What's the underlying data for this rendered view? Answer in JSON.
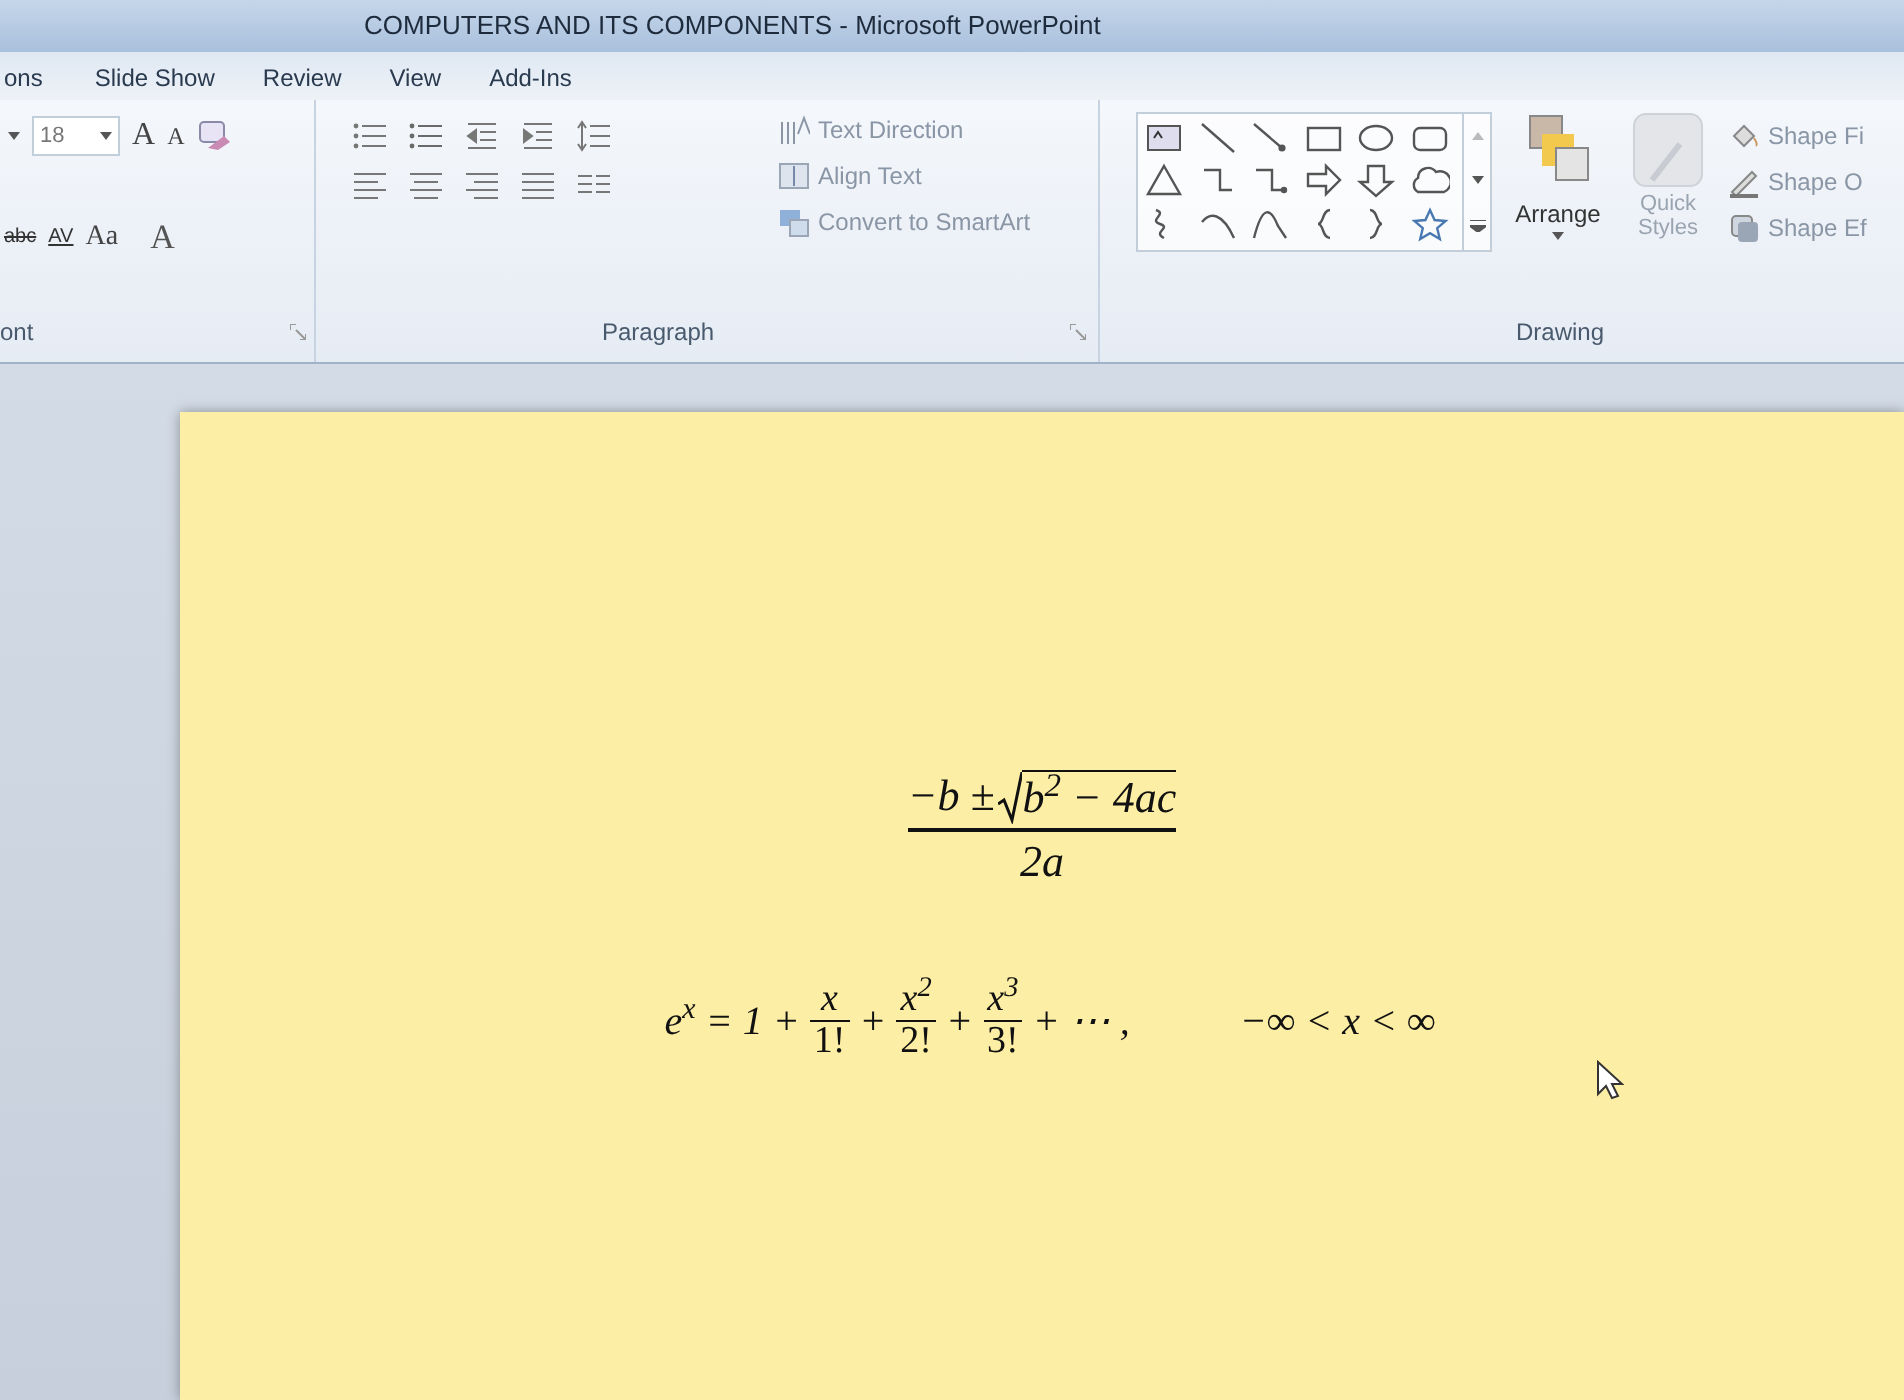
{
  "window": {
    "title": "COMPUTERS AND ITS COMPONENTS  -  Microsoft PowerPoint"
  },
  "tabs": [
    {
      "label": "ons",
      "selected": false
    },
    {
      "label": "Slide Show",
      "selected": false
    },
    {
      "label": "Review",
      "selected": false
    },
    {
      "label": "View",
      "selected": false
    },
    {
      "label": "Add-Ins",
      "selected": false
    }
  ],
  "ribbon": {
    "font_group": {
      "label": "ont",
      "size_value": "18",
      "grow_label": "A",
      "shrink_label": "A",
      "strike_label": "abc",
      "spacing_label": "AV",
      "case_label": "Aa",
      "color_label": "A"
    },
    "paragraph_group": {
      "label": "Paragraph",
      "text_direction": "Text Direction",
      "align_text": "Align Text",
      "convert_smartart": "Convert to SmartArt"
    },
    "drawing_group": {
      "label": "Drawing",
      "arrange": "Arrange",
      "quick_styles": "Quick Styles",
      "shape_fill": "Shape Fi",
      "shape_outline": "Shape O",
      "shape_effects": "Shape Ef"
    }
  },
  "slide": {
    "equations": [
      {
        "kind": "fraction",
        "numerator_prefix": "−b ±",
        "radicand": "b$^{2}$ − 4ac",
        "denominator": "2a"
      },
      {
        "kind": "series",
        "items": [
          {
            "kind": "text",
            "text": "e$^{x}$ = 1 +"
          },
          {
            "kind": "fraction",
            "numerator": "x",
            "denominator": "1!"
          },
          {
            "kind": "text",
            "text": "+"
          },
          {
            "kind": "fraction",
            "numerator": "x$^{2}$",
            "denominator": "2!"
          },
          {
            "kind": "text",
            "text": "+"
          },
          {
            "kind": "fraction",
            "numerator": "x$^{3}$",
            "denominator": "3!"
          },
          {
            "kind": "text",
            "text": "+ ⋯ ,"
          }
        ],
        "condition": "−∞ < x < ∞"
      }
    ]
  }
}
